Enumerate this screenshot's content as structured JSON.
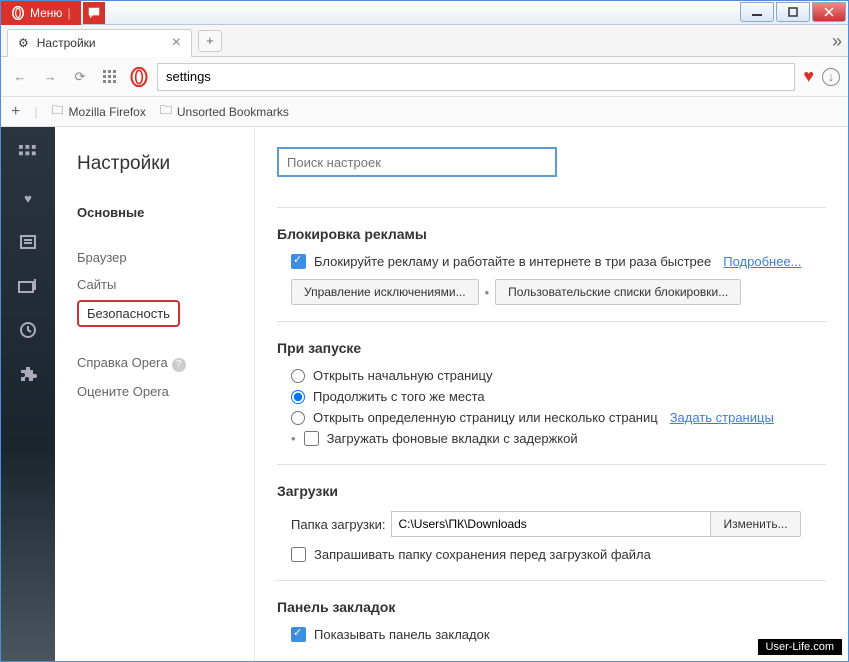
{
  "titlebar": {
    "menu": "Меню"
  },
  "tab": {
    "title": "Настройки"
  },
  "address": {
    "value": "settings"
  },
  "bookmarks_bar": {
    "add": "+",
    "folders": [
      "Mozilla Firefox",
      "Unsorted Bookmarks"
    ]
  },
  "sidebar": {
    "title": "Настройки",
    "main": "Основные",
    "items": [
      "Браузер",
      "Сайты",
      "Безопасность"
    ],
    "footer": [
      "Справка Opera",
      "Оцените Opera"
    ]
  },
  "search": {
    "placeholder": "Поиск настроек"
  },
  "sections": {
    "ads": {
      "title": "Блокировка рекламы",
      "checkbox": "Блокируйте рекламу и работайте в интернете в три раза быстрее",
      "more": "Подробнее...",
      "buttons": [
        "Управление исключениями...",
        "Пользовательские списки блокировки..."
      ]
    },
    "startup": {
      "title": "При запуске",
      "opts": [
        "Открыть начальную страницу",
        "Продолжить с того же места",
        "Открыть определенную страницу или несколько страниц"
      ],
      "setpages": "Задать страницы",
      "bg": "Загружать фоновые вкладки с задержкой"
    },
    "downloads": {
      "title": "Загрузки",
      "label": "Папка загрузки:",
      "path": "C:\\Users\\ПК\\Downloads",
      "change": "Изменить...",
      "ask": "Запрашивать папку сохранения перед загрузкой файла"
    },
    "bookmarks": {
      "title": "Панель закладок",
      "show": "Показывать панель закладок"
    }
  },
  "watermark": "User-Life.com"
}
